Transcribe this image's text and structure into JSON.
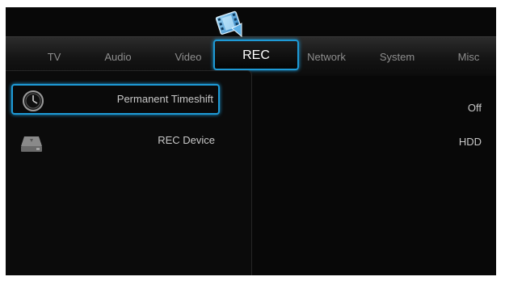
{
  "tabs": [
    {
      "label": "TV"
    },
    {
      "label": "Audio"
    },
    {
      "label": "Video"
    },
    {
      "label": "REC"
    },
    {
      "label": "Network"
    },
    {
      "label": "System"
    },
    {
      "label": "Misc"
    }
  ],
  "active_tab": "REC",
  "settings": [
    {
      "label": "Permanent Timeshift",
      "value": "Off",
      "icon": "clock-icon",
      "selected": true
    },
    {
      "label": "REC Device",
      "value": "HDD",
      "icon": "hard-drive-icon",
      "selected": false
    }
  ],
  "colors": {
    "accent": "#1e9ad6",
    "background": "#080808",
    "text": "#c8c8c8",
    "tab_text": "#8e8e8e"
  }
}
